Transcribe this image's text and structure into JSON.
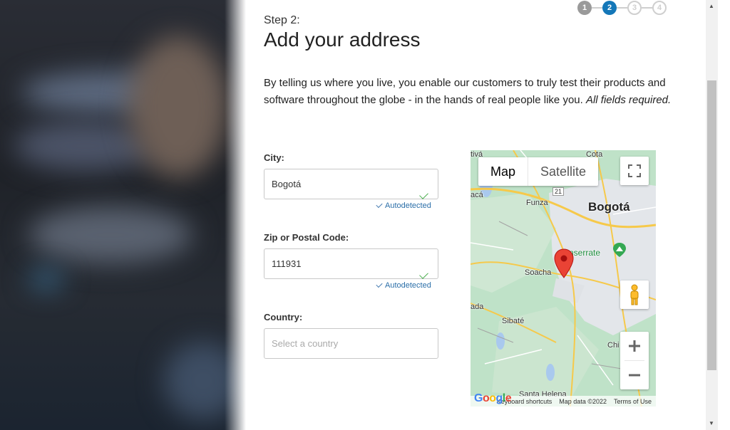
{
  "stepper": {
    "steps": [
      "1",
      "2",
      "3",
      "4"
    ],
    "current": 2
  },
  "header": {
    "step_label": "Step 2:",
    "title": "Add your address"
  },
  "intro": {
    "text": "By telling us where you live, you enable our customers to truly test their products and software throughout the globe - in the hands of real people like you.",
    "emphasis": "All fields required."
  },
  "form": {
    "city": {
      "label": "City:",
      "value": "Bogotá",
      "status": "Autodetected"
    },
    "zip": {
      "label": "Zip or Postal Code:",
      "value": "111931",
      "status": "Autodetected"
    },
    "country": {
      "label": "Country:",
      "placeholder": "Select a country"
    }
  },
  "map": {
    "type_map": "Map",
    "type_satellite": "Satellite",
    "labels": {
      "bogota": "Bogotá",
      "funza": "Funza",
      "soacha": "Soacha",
      "monserrate": "nserrate",
      "sibate": "Sibaté",
      "cota": "Cota",
      "tiva": "tivá",
      "aca": "acá",
      "ada": "ada",
      "chi": "Chi",
      "santa_helena": "Santa Helena",
      "route": "21"
    },
    "footer": {
      "shortcuts": "Keyboard shortcuts",
      "data": "Map data ©2022",
      "terms": "Terms of Use"
    },
    "logo": "Google"
  },
  "colors": {
    "accent": "#1477b8",
    "pin": "#ea4335",
    "link": "#2a6ea8",
    "check": "#4caf50"
  }
}
